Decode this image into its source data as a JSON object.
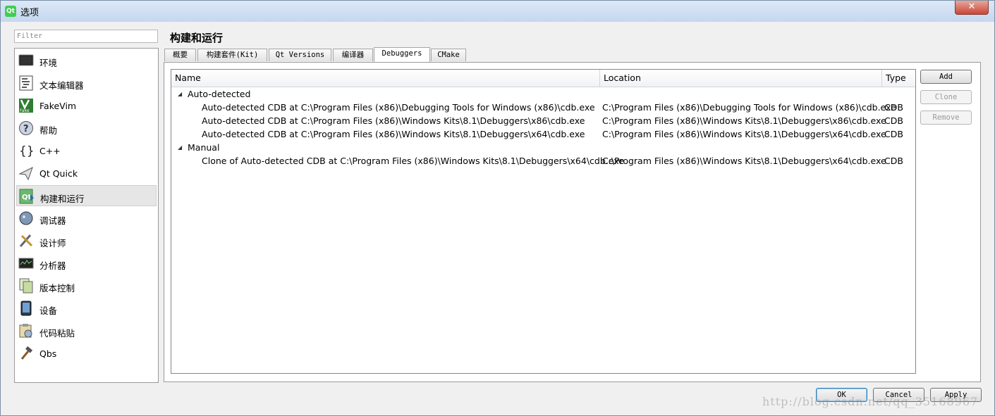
{
  "window": {
    "title": "选项",
    "app_icon": "Qt",
    "close_glyph": "✕"
  },
  "filter": {
    "placeholder": "Filter"
  },
  "sidebar": {
    "items": [
      {
        "label": "环境",
        "icon": "monitor-icon"
      },
      {
        "label": "文本编辑器",
        "icon": "text-editor-icon"
      },
      {
        "label": "FakeVim",
        "icon": "fakevim-icon"
      },
      {
        "label": "帮助",
        "icon": "help-icon"
      },
      {
        "label": "C++",
        "icon": "braces-icon"
      },
      {
        "label": "Qt Quick",
        "icon": "paper-plane-icon"
      },
      {
        "label": "构建和运行",
        "icon": "build-run-icon",
        "selected": true
      },
      {
        "label": "调试器",
        "icon": "debugger-icon"
      },
      {
        "label": "设计师",
        "icon": "designer-icon"
      },
      {
        "label": "分析器",
        "icon": "analyzer-icon"
      },
      {
        "label": "版本控制",
        "icon": "version-control-icon"
      },
      {
        "label": "设备",
        "icon": "device-icon"
      },
      {
        "label": "代码粘贴",
        "icon": "code-paste-icon"
      },
      {
        "label": "Qbs",
        "icon": "hammer-icon"
      }
    ]
  },
  "main": {
    "title": "构建和运行",
    "tabs": [
      {
        "label": "概要"
      },
      {
        "label": "构建套件(Kit)"
      },
      {
        "label": "Qt Versions"
      },
      {
        "label": "编译器"
      },
      {
        "label": "Debuggers",
        "active": true
      },
      {
        "label": "CMake"
      }
    ],
    "columns": {
      "name": "Name",
      "location": "Location",
      "type": "Type"
    },
    "groups": [
      {
        "label": "Auto-detected",
        "rows": [
          {
            "name": "Auto-detected CDB at C:\\Program Files (x86)\\Debugging Tools for Windows (x86)\\cdb.exe",
            "location": "C:\\Program Files (x86)\\Debugging Tools for Windows (x86)\\cdb.exe",
            "type": "CDB"
          },
          {
            "name": "Auto-detected CDB at C:\\Program Files (x86)\\Windows Kits\\8.1\\Debuggers\\x86\\cdb.exe",
            "location": "C:\\Program Files (x86)\\Windows Kits\\8.1\\Debuggers\\x86\\cdb.exe",
            "type": "CDB"
          },
          {
            "name": "Auto-detected CDB at C:\\Program Files (x86)\\Windows Kits\\8.1\\Debuggers\\x64\\cdb.exe",
            "location": "C:\\Program Files (x86)\\Windows Kits\\8.1\\Debuggers\\x64\\cdb.exe",
            "type": "CDB"
          }
        ]
      },
      {
        "label": "Manual",
        "rows": [
          {
            "name": "Clone of Auto-detected CDB at C:\\Program Files (x86)\\Windows Kits\\8.1\\Debuggers\\x64\\cdb.exe",
            "location": "C:\\Program Files (x86)\\Windows Kits\\8.1\\Debuggers\\x64\\cdb.exe",
            "type": "CDB"
          }
        ]
      }
    ],
    "side_buttons": {
      "add": "Add",
      "clone": "Clone",
      "remove": "Remove"
    }
  },
  "footer": {
    "ok": "OK",
    "cancel": "Cancel",
    "apply": "Apply"
  },
  "watermark": "http://blog.csdn.net/qq_35168967"
}
